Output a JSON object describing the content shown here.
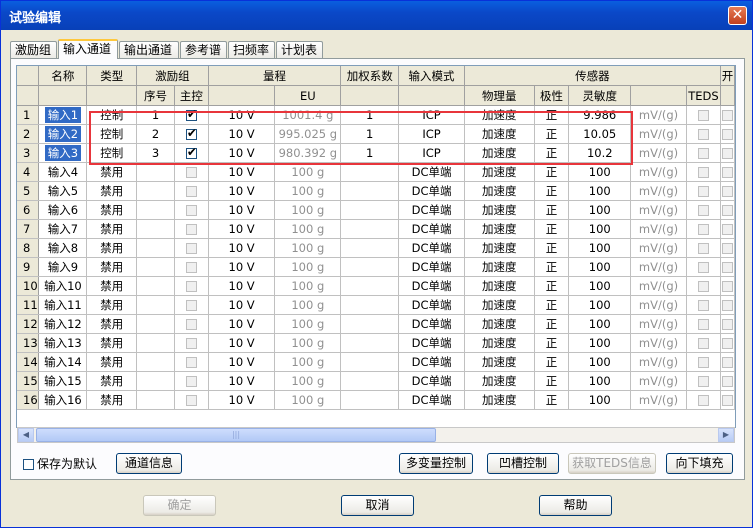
{
  "window": {
    "title": "试验编辑",
    "close_glyph": "✕"
  },
  "tabs": [
    "激励组",
    "输入通道",
    "输出通道",
    "参考谱",
    "扫频率",
    "计划表"
  ],
  "active_tab": 1,
  "headers": {
    "name": "名称",
    "type": "类型",
    "excite_group": "激励组",
    "range": "量程",
    "weight": "加权系数",
    "mode": "输入模式",
    "sensor": "传感器",
    "seq": "序号",
    "master": "主控",
    "eu": "EU",
    "physical": "物理量",
    "polarity": "极性",
    "sensitivity": "灵敏度",
    "teds": "TEDS",
    "extra": "开"
  },
  "rows": [
    {
      "n": "1",
      "name": "输入1",
      "type": "控制",
      "seq": "1",
      "master": true,
      "range": "10 V",
      "eu": "1001.4 g",
      "weight": "1",
      "mode": "ICP",
      "phys": "加速度",
      "pol": "正",
      "sens": "9.986",
      "unit": "mV/(g)"
    },
    {
      "n": "2",
      "name": "输入2",
      "type": "控制",
      "seq": "2",
      "master": true,
      "range": "10 V",
      "eu": "995.025 g",
      "weight": "1",
      "mode": "ICP",
      "phys": "加速度",
      "pol": "正",
      "sens": "10.05",
      "unit": "mV/(g)"
    },
    {
      "n": "3",
      "name": "输入3",
      "type": "控制",
      "seq": "3",
      "master": true,
      "range": "10 V",
      "eu": "980.392 g",
      "weight": "1",
      "mode": "ICP",
      "phys": "加速度",
      "pol": "正",
      "sens": "10.2",
      "unit": "mV/(g)"
    },
    {
      "n": "4",
      "name": "输入4",
      "type": "禁用",
      "seq": "",
      "master": false,
      "range": "10 V",
      "eu": "100 g",
      "weight": "",
      "mode": "DC单端",
      "phys": "加速度",
      "pol": "正",
      "sens": "100",
      "unit": "mV/(g)"
    },
    {
      "n": "5",
      "name": "输入5",
      "type": "禁用",
      "seq": "",
      "master": false,
      "range": "10 V",
      "eu": "100 g",
      "weight": "",
      "mode": "DC单端",
      "phys": "加速度",
      "pol": "正",
      "sens": "100",
      "unit": "mV/(g)"
    },
    {
      "n": "6",
      "name": "输入6",
      "type": "禁用",
      "seq": "",
      "master": false,
      "range": "10 V",
      "eu": "100 g",
      "weight": "",
      "mode": "DC单端",
      "phys": "加速度",
      "pol": "正",
      "sens": "100",
      "unit": "mV/(g)"
    },
    {
      "n": "7",
      "name": "输入7",
      "type": "禁用",
      "seq": "",
      "master": false,
      "range": "10 V",
      "eu": "100 g",
      "weight": "",
      "mode": "DC单端",
      "phys": "加速度",
      "pol": "正",
      "sens": "100",
      "unit": "mV/(g)"
    },
    {
      "n": "8",
      "name": "输入8",
      "type": "禁用",
      "seq": "",
      "master": false,
      "range": "10 V",
      "eu": "100 g",
      "weight": "",
      "mode": "DC单端",
      "phys": "加速度",
      "pol": "正",
      "sens": "100",
      "unit": "mV/(g)"
    },
    {
      "n": "9",
      "name": "输入9",
      "type": "禁用",
      "seq": "",
      "master": false,
      "range": "10 V",
      "eu": "100 g",
      "weight": "",
      "mode": "DC单端",
      "phys": "加速度",
      "pol": "正",
      "sens": "100",
      "unit": "mV/(g)"
    },
    {
      "n": "10",
      "name": "输入10",
      "type": "禁用",
      "seq": "",
      "master": false,
      "range": "10 V",
      "eu": "100 g",
      "weight": "",
      "mode": "DC单端",
      "phys": "加速度",
      "pol": "正",
      "sens": "100",
      "unit": "mV/(g)"
    },
    {
      "n": "11",
      "name": "输入11",
      "type": "禁用",
      "seq": "",
      "master": false,
      "range": "10 V",
      "eu": "100 g",
      "weight": "",
      "mode": "DC单端",
      "phys": "加速度",
      "pol": "正",
      "sens": "100",
      "unit": "mV/(g)"
    },
    {
      "n": "12",
      "name": "输入12",
      "type": "禁用",
      "seq": "",
      "master": false,
      "range": "10 V",
      "eu": "100 g",
      "weight": "",
      "mode": "DC单端",
      "phys": "加速度",
      "pol": "正",
      "sens": "100",
      "unit": "mV/(g)"
    },
    {
      "n": "13",
      "name": "输入13",
      "type": "禁用",
      "seq": "",
      "master": false,
      "range": "10 V",
      "eu": "100 g",
      "weight": "",
      "mode": "DC单端",
      "phys": "加速度",
      "pol": "正",
      "sens": "100",
      "unit": "mV/(g)"
    },
    {
      "n": "14",
      "name": "输入14",
      "type": "禁用",
      "seq": "",
      "master": false,
      "range": "10 V",
      "eu": "100 g",
      "weight": "",
      "mode": "DC单端",
      "phys": "加速度",
      "pol": "正",
      "sens": "100",
      "unit": "mV/(g)"
    },
    {
      "n": "15",
      "name": "输入15",
      "type": "禁用",
      "seq": "",
      "master": false,
      "range": "10 V",
      "eu": "100 g",
      "weight": "",
      "mode": "DC单端",
      "phys": "加速度",
      "pol": "正",
      "sens": "100",
      "unit": "mV/(g)"
    },
    {
      "n": "16",
      "name": "输入16",
      "type": "禁用",
      "seq": "",
      "master": false,
      "range": "10 V",
      "eu": "100 g",
      "weight": "",
      "mode": "DC单端",
      "phys": "加速度",
      "pol": "正",
      "sens": "100",
      "unit": "mV/(g)"
    }
  ],
  "scroll": {
    "left": "◀",
    "right": "▶",
    "grip": "|||"
  },
  "bottom": {
    "save_default": "保存为默认",
    "channel_info": "通道信息",
    "multi_var": "多变量控制",
    "notch": "凹槽控制",
    "get_teds": "获取TEDS信息",
    "fill_down": "向下填充",
    "ok": "确定",
    "cancel": "取消",
    "help": "帮助"
  },
  "colors": {
    "selection": "#316AC5",
    "highlight_box": "#E8353B",
    "titlebar": "#0A48C8"
  }
}
